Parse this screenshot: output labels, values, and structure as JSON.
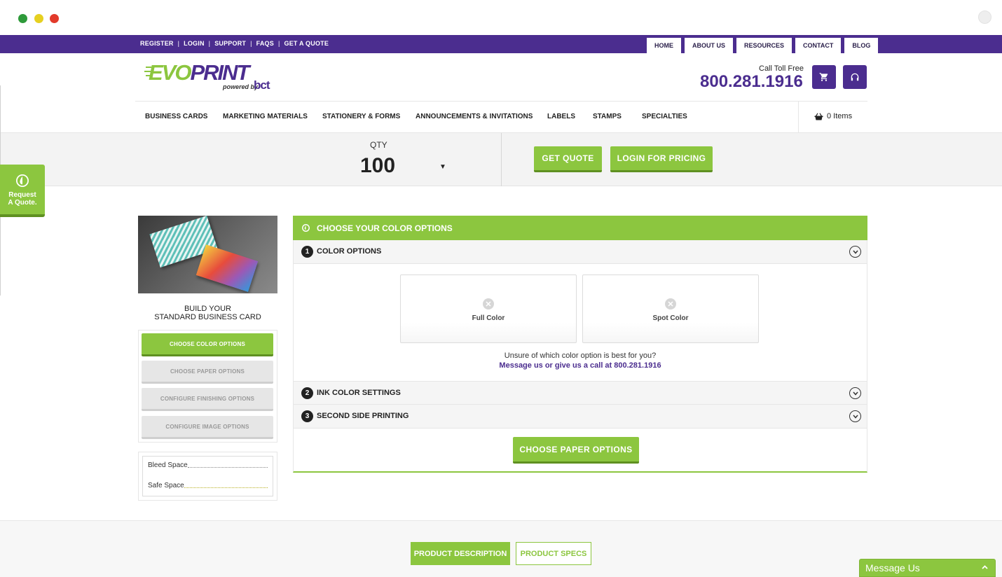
{
  "window": {
    "dots": [
      "#2e9a3a",
      "#e6d020",
      "#e23a2a"
    ]
  },
  "topbar": {
    "links": [
      "REGISTER",
      "LOGIN",
      "SUPPORT",
      "FAQS",
      "GET A QUOTE"
    ],
    "tabs": [
      "HOME",
      "ABOUT US",
      "RESOURCES",
      "CONTACT",
      "BLOG"
    ]
  },
  "header": {
    "logo_evo": "EVO",
    "logo_print": "PRINT",
    "logo_powered": "powered by",
    "logo_bct": "bct",
    "call_label": "Call Toll Free",
    "phone": "800.281.1916",
    "cart_icon": "cart-icon",
    "support_icon": "headset-icon"
  },
  "nav": {
    "items": [
      "BUSINESS CARDS",
      "MARKETING MATERIALS",
      "STATIONERY & FORMS",
      "ANNOUNCEMENTS & INVITATIONS",
      "LABELS",
      "STAMPS",
      "SPECIALTIES"
    ],
    "cart_items": "0 Items"
  },
  "qty": {
    "label": "QTY",
    "value": "100",
    "caret": "▼",
    "get_quote": "GET QUOTE",
    "login_pricing": "LOGIN FOR PRICING"
  },
  "request_tab": {
    "line1": "Request",
    "line2": "A Quote."
  },
  "product": {
    "build_line1": "BUILD YOUR",
    "build_line2": "STANDARD BUSINESS CARD",
    "steps": [
      "CHOOSE COLOR OPTIONS",
      "CHOOSE PAPER OPTIONS",
      "CONFIGURE FINISHING OPTIONS",
      "CONFIGURE IMAGE OPTIONS"
    ],
    "active_step": 0,
    "bleed_label": "Bleed Space",
    "safe_label": "Safe Space"
  },
  "panel": {
    "title": "CHOOSE YOUR COLOR OPTIONS",
    "sections": [
      {
        "num": "1",
        "title": "COLOR OPTIONS"
      },
      {
        "num": "2",
        "title": "INK COLOR SETTINGS"
      },
      {
        "num": "3",
        "title": "SECOND SIDE PRINTING"
      }
    ],
    "options": [
      "Full Color",
      "Spot Color"
    ],
    "unsure": "Unsure of which color option is best for you?",
    "unsure_link": "Message us or give us a call at 800.281.1916",
    "next_button": "CHOOSE PAPER OPTIONS"
  },
  "bottom": {
    "tab_description": "PRODUCT DESCRIPTION",
    "tab_specs": "PRODUCT SPECS",
    "message": "Message Us"
  },
  "colors": {
    "purple": "#4b2d8f",
    "green": "#8cc63f",
    "green_dark": "#5f9021"
  }
}
